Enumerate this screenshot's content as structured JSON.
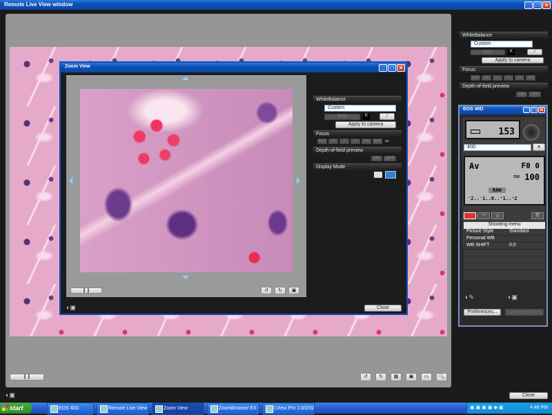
{
  "main_window": {
    "title": "Remote Live View window",
    "close_label": "Close"
  },
  "zoom_view": {
    "title": "Zoom View",
    "close_label": "Close"
  },
  "side_panel": {
    "white_balance": {
      "title": "WhiteBalance",
      "mode": "Custom",
      "kelvin": "5200",
      "k_label": "K",
      "apply_label": "Apply to camera"
    },
    "focus": {
      "title": "Focus",
      "buttons": [
        "<<<",
        "<<",
        "<",
        ">",
        ">>",
        ">>>"
      ],
      "inf": "∞"
    },
    "dof": {
      "title": "Depth-of-field preview",
      "on": "ON",
      "off": "OFF"
    },
    "display_mode": {
      "title": "Display Mode"
    }
  },
  "camera": {
    "title": "EOS 40D",
    "shots": "153",
    "model_select": "40D",
    "mode": "Av",
    "aperture": "F0 0",
    "iso_label": "ISO",
    "iso": "100",
    "quality": "RAW",
    "exposure_scale": "⁻2..⁻1..0..⁺1..⁺2",
    "shooting_menu_title": "Shooting menu",
    "menu_rows": [
      {
        "label": "Picture Style",
        "value": "Standard"
      },
      {
        "label": "Personal WB",
        "value": ""
      },
      {
        "label": "WB SHIFT",
        "value": "0,0"
      },
      {
        "label": "",
        "value": ""
      },
      {
        "label": "",
        "value": ""
      },
      {
        "label": "",
        "value": ""
      }
    ],
    "preferences_label": "Preferences...",
    "disabled_btn_label": "Camera settings"
  },
  "taskbar": {
    "start_label": "start",
    "items": [
      "EOS 40D",
      "Remote Live View win...",
      "Zoom View",
      "ZoomBrowser EX - A...",
      "LView Pro 1.0/2/32"
    ],
    "active_index": 2,
    "clock": "4:46 PM"
  }
}
